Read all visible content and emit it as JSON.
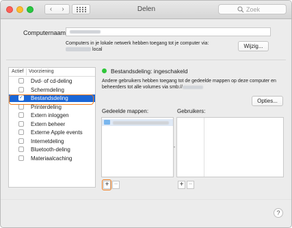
{
  "window": {
    "title": "Delen",
    "search_placeholder": "Zoek"
  },
  "computer_name": {
    "label": "Computernaam:",
    "network_info_line1": "Computers in je lokale netwerk hebben toegang tot je computer via:",
    "network_info_line2_suffix": "local",
    "edit_button": "Wijzig..."
  },
  "services": {
    "header_active": "Actief",
    "header_service": "Voorziening",
    "items": [
      {
        "label": "Dvd- of cd-deling",
        "checked": false,
        "selected": false
      },
      {
        "label": "Schermdeling",
        "checked": false,
        "selected": false
      },
      {
        "label": "Bestandsdeling",
        "checked": true,
        "selected": true
      },
      {
        "label": "Printerdeling",
        "checked": false,
        "selected": false
      },
      {
        "label": "Extern inloggen",
        "checked": false,
        "selected": false
      },
      {
        "label": "Extern beheer",
        "checked": false,
        "selected": false
      },
      {
        "label": "Externe Apple events",
        "checked": false,
        "selected": false
      },
      {
        "label": "Internetdeling",
        "checked": false,
        "selected": false
      },
      {
        "label": "Bluetooth-deling",
        "checked": false,
        "selected": false
      },
      {
        "label": "Materiaalcaching",
        "checked": false,
        "selected": false
      }
    ]
  },
  "detail": {
    "status_title": "Bestandsdeling: ingeschakeld",
    "status_color": "#2fc63a",
    "description": "Andere gebruikers hebben toegang tot de gedeelde mappen op deze computer en beheerders tot alle volumes via smb://",
    "options_button": "Opties...",
    "shared_folders_label": "Gedeelde mappen:",
    "users_label": "Gebruikers:",
    "add_symbol": "+",
    "remove_symbol": "−"
  },
  "help_symbol": "?",
  "colors": {
    "selection": "#1b66d6",
    "highlight_ring": "#f07b1a"
  }
}
